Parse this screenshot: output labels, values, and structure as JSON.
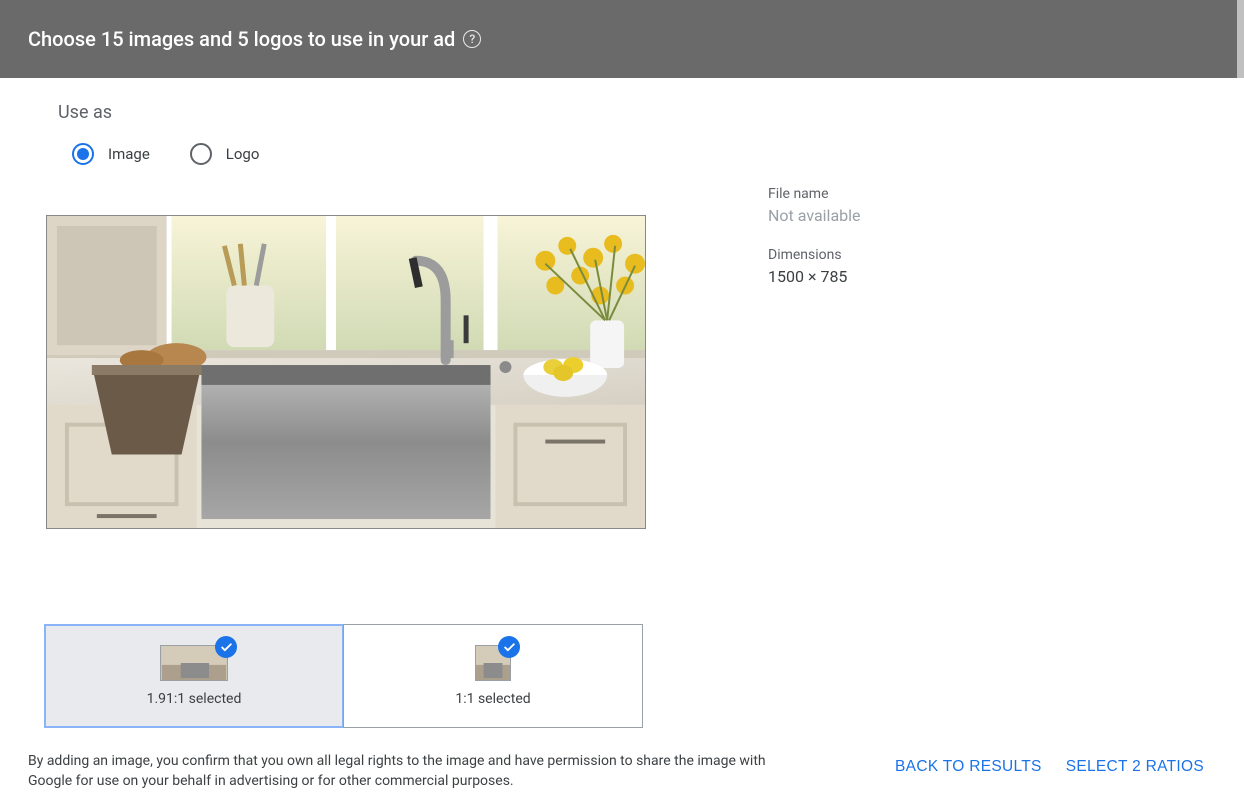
{
  "header": {
    "title": "Choose 15 images and 5 logos to use in your ad"
  },
  "use_as": {
    "label": "Use as",
    "options": [
      {
        "label": "Image",
        "selected": true
      },
      {
        "label": "Logo",
        "selected": false
      }
    ]
  },
  "meta": {
    "file_name_label": "File name",
    "file_name_value": "Not available",
    "dimensions_label": "Dimensions",
    "dimensions_value": "1500 × 785"
  },
  "ratios": [
    {
      "ratio": "1.91:1",
      "label": "1.91:1 selected",
      "active": true,
      "shape": "wide"
    },
    {
      "ratio": "1:1",
      "label": "1:1 selected",
      "active": false,
      "shape": "square"
    }
  ],
  "disclaimer": "By adding an image, you confirm that you own all legal rights to the image and have permission to share the image with Google for use on your behalf in advertising or for other commercial purposes.",
  "footer": {
    "back": "BACK TO RESULTS",
    "select": "SELECT 2 RATIOS"
  }
}
